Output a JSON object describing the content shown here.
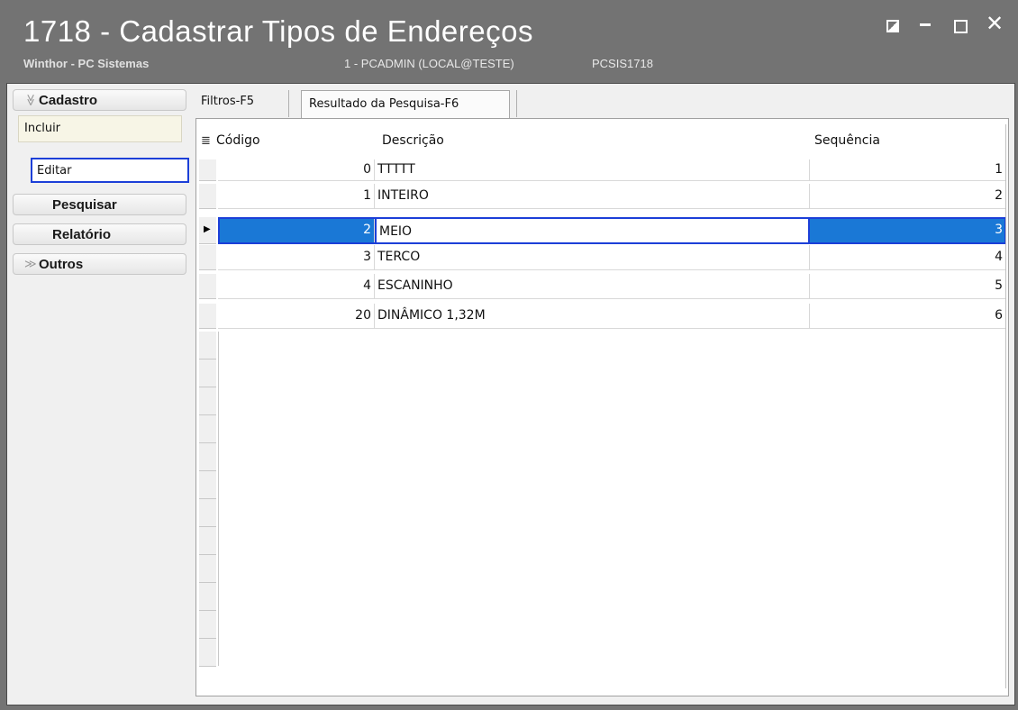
{
  "window": {
    "title": "1718 - Cadastrar Tipos de Endereços",
    "company": "Winthor - PC Sistemas",
    "user": "1 - PCADMIN (LOCAL@TESTE)",
    "program": "PCSIS1718",
    "close_glyph": "✕"
  },
  "sidebar": {
    "cadastro": "Cadastro",
    "cadastro_chev": "≫",
    "incluir": "Incluir",
    "editar": "Editar",
    "pesquisar": "Pesquisar",
    "relatorio": "Relatório",
    "outros": "Outros",
    "outros_chev": "≫"
  },
  "tabs": {
    "filtros": "Filtros-F5",
    "resultado": "Resultado da Pesquisa-F6"
  },
  "grid": {
    "headers": {
      "codigo": "Código",
      "descricao": "Descrição",
      "sequencia": "Sequência"
    },
    "header_icon": "≣",
    "rows": [
      {
        "codigo": "0",
        "descricao": "TTTTT",
        "sequencia": "1"
      },
      {
        "codigo": "1",
        "descricao": "INTEIRO",
        "sequencia": "2"
      },
      {
        "codigo": "2",
        "descricao": "MEIO",
        "sequencia": "3"
      },
      {
        "codigo": "3",
        "descricao": "TERCO",
        "sequencia": "4"
      },
      {
        "codigo": "4",
        "descricao": "ESCANINHO",
        "sequencia": "5"
      },
      {
        "codigo": "20",
        "descricao": "DINÂMICO 1,32M",
        "sequencia": "6"
      }
    ],
    "selected_row_index": 2,
    "current_row_marker": "▶"
  },
  "colors": {
    "selection": "#1a78d6",
    "focus_border": "#1c3fd8",
    "titlebar": "#737373"
  }
}
